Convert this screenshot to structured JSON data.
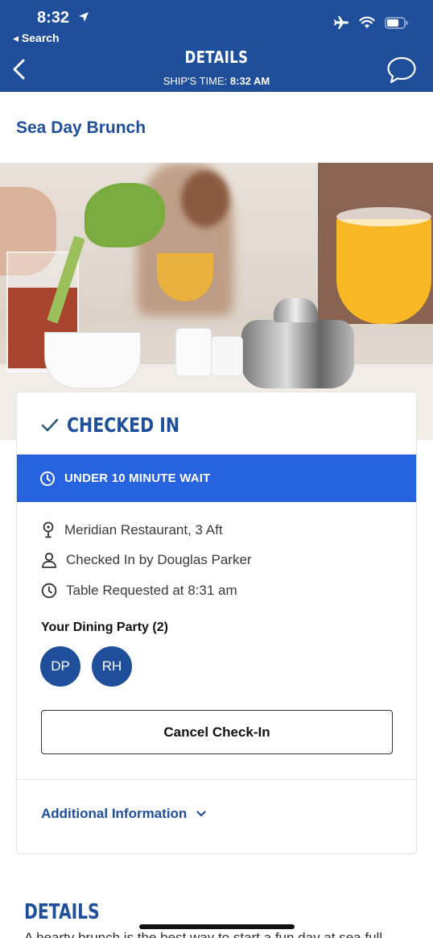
{
  "status_bar": {
    "time": "8:32",
    "back_app": "◂ Search"
  },
  "nav": {
    "title": "DETAILS",
    "ships_time_label": "SHIP'S TIME:",
    "ships_time_value": "8:32 AM"
  },
  "event": {
    "title": "Sea Day Brunch"
  },
  "card": {
    "status": "CHECKED IN",
    "wait": "UNDER 10 MINUTE WAIT",
    "location": "Meridian Restaurant, 3 Aft",
    "checked_in_by": "Checked In by Douglas Parker",
    "table_requested": "Table Requested at 8:31 am",
    "party_title": "Your Dining Party (2)",
    "party": [
      "DP",
      "RH"
    ],
    "cancel_label": "Cancel Check-In",
    "additional_label": "Additional Information"
  },
  "details": {
    "heading": "DETAILS",
    "text": "A hearty brunch is the best way to start a fun day at sea full"
  },
  "colors": {
    "brand_blue": "#1f4e9a",
    "accent_blue": "#2763de"
  }
}
